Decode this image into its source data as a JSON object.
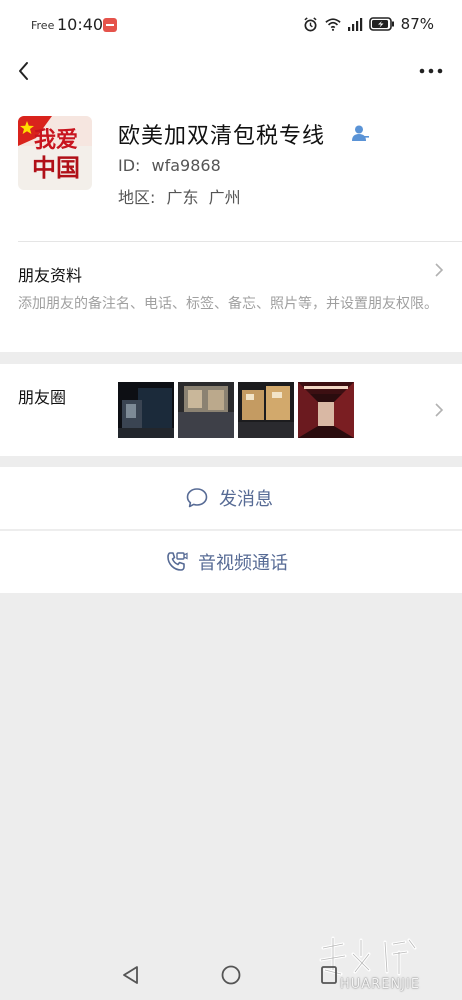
{
  "status_bar": {
    "carrier": "Free",
    "time": "10:40",
    "battery": "87%"
  },
  "top_nav": {
    "back_icon": "chevron-left-icon",
    "more_icon": "more-horizontal-icon"
  },
  "profile": {
    "avatar_text_1": "我爱",
    "avatar_text_2": "中国",
    "name": "欧美加双清包税专线",
    "id_label": "ID:",
    "id_value": "wfa9868",
    "region_label": "地区:",
    "region_value": "广东  广州"
  },
  "friend_info": {
    "title": "朋友资料",
    "description": "添加朋友的备注名、电话、标签、备忘、照片等，并设置朋友权限。"
  },
  "moments": {
    "title": "朋友圈"
  },
  "actions": {
    "message_label": "发消息",
    "call_label": "音视频通话"
  },
  "watermark": {
    "text": "HUARENJIE"
  },
  "colors": {
    "link_blue": "#576b95",
    "background": "#ededed"
  }
}
